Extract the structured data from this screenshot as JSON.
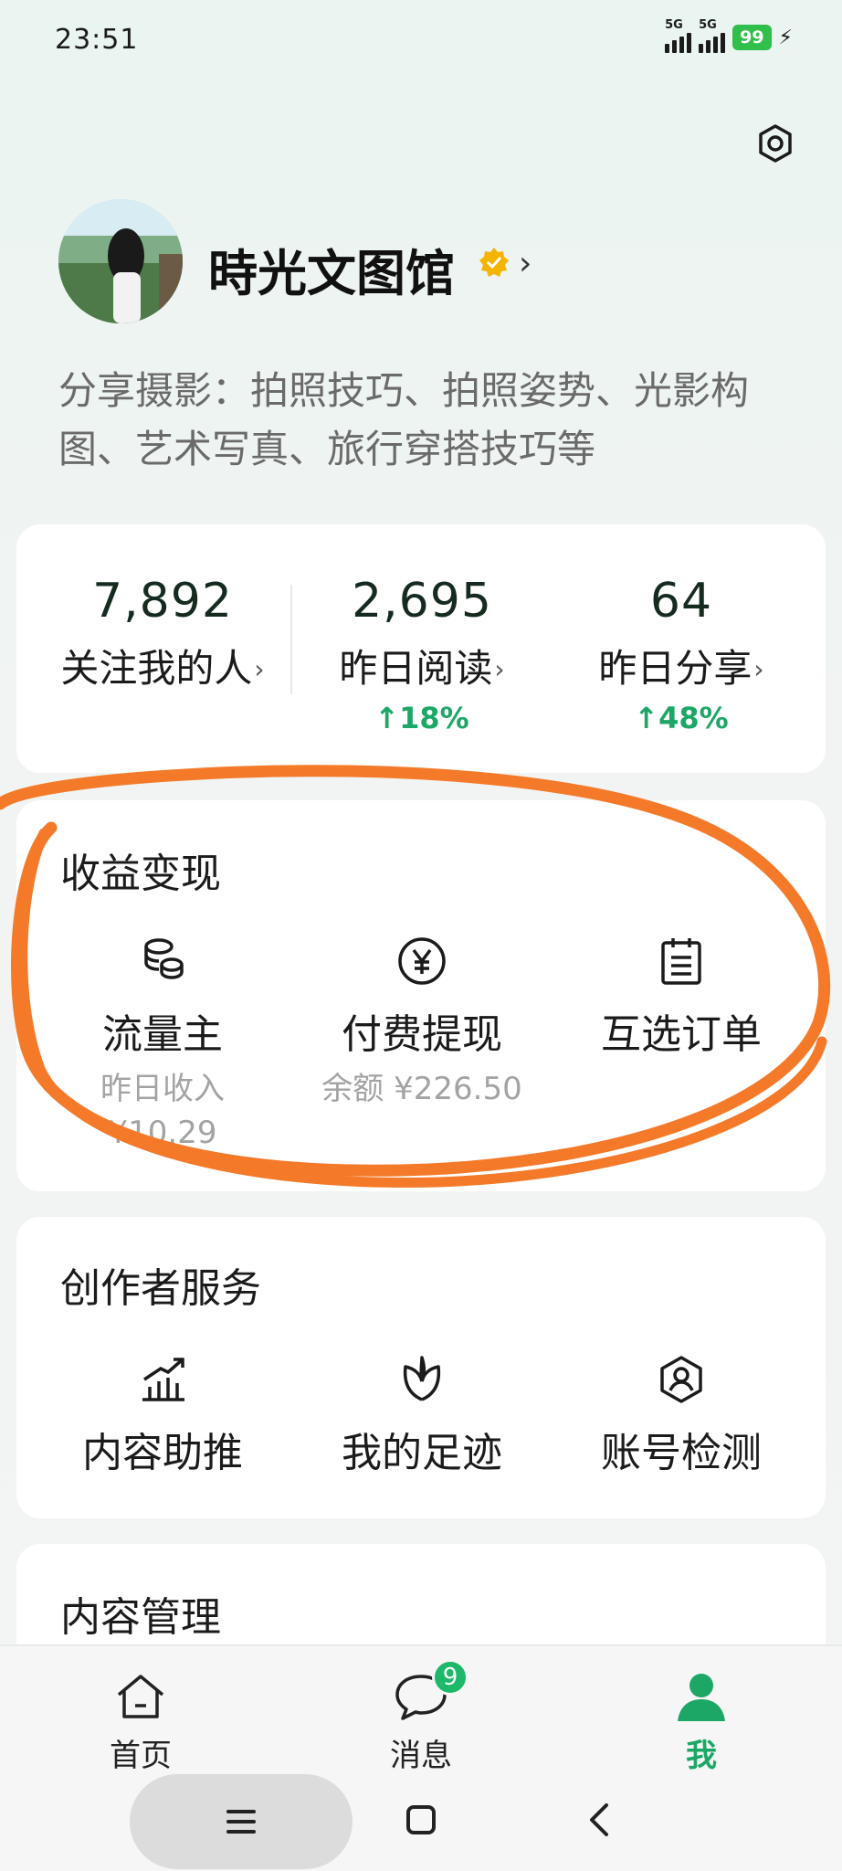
{
  "status_bar": {
    "time": "23:51",
    "net1": "5G",
    "net2": "5G",
    "battery": "99"
  },
  "profile": {
    "name": "時光文图馆",
    "chevron": "›",
    "bio": "分享摄影：拍照技巧、拍照姿势、光影构图、艺术写真、旅行穿搭技巧等"
  },
  "stats": [
    {
      "value": "7,892",
      "label": "关注我的人",
      "change": ""
    },
    {
      "value": "2,695",
      "label": "昨日阅读",
      "change": "↑18%"
    },
    {
      "value": "64",
      "label": "昨日分享",
      "change": "↑48%"
    }
  ],
  "earnings": {
    "title": "收益变现",
    "items": [
      {
        "label": "流量主",
        "sub1": "昨日收入",
        "sub2": "¥10.29",
        "icon": "coins-icon"
      },
      {
        "label": "付费提现",
        "sub1": "余额 ¥226.50",
        "sub2": "",
        "icon": "yen-icon"
      },
      {
        "label": "互选订单",
        "sub1": "",
        "sub2": "",
        "icon": "clipboard-icon"
      }
    ]
  },
  "creator_services": {
    "title": "创作者服务",
    "items": [
      {
        "label": "内容助推",
        "icon": "chart-growth-icon"
      },
      {
        "label": "我的足迹",
        "icon": "leaf-icon"
      },
      {
        "label": "账号检测",
        "icon": "user-shield-icon"
      }
    ]
  },
  "content_management": {
    "title": "内容管理"
  },
  "bottom_nav": {
    "items": [
      {
        "label": "首页",
        "icon": "home-icon",
        "active": false
      },
      {
        "label": "消息",
        "icon": "chat-icon",
        "active": false,
        "badge": "9"
      },
      {
        "label": "我",
        "icon": "person-icon",
        "active": true
      }
    ]
  },
  "colors": {
    "accent_green": "#1da766",
    "annotation_orange": "#f47a2a",
    "verified_gold": "#f5b400"
  }
}
